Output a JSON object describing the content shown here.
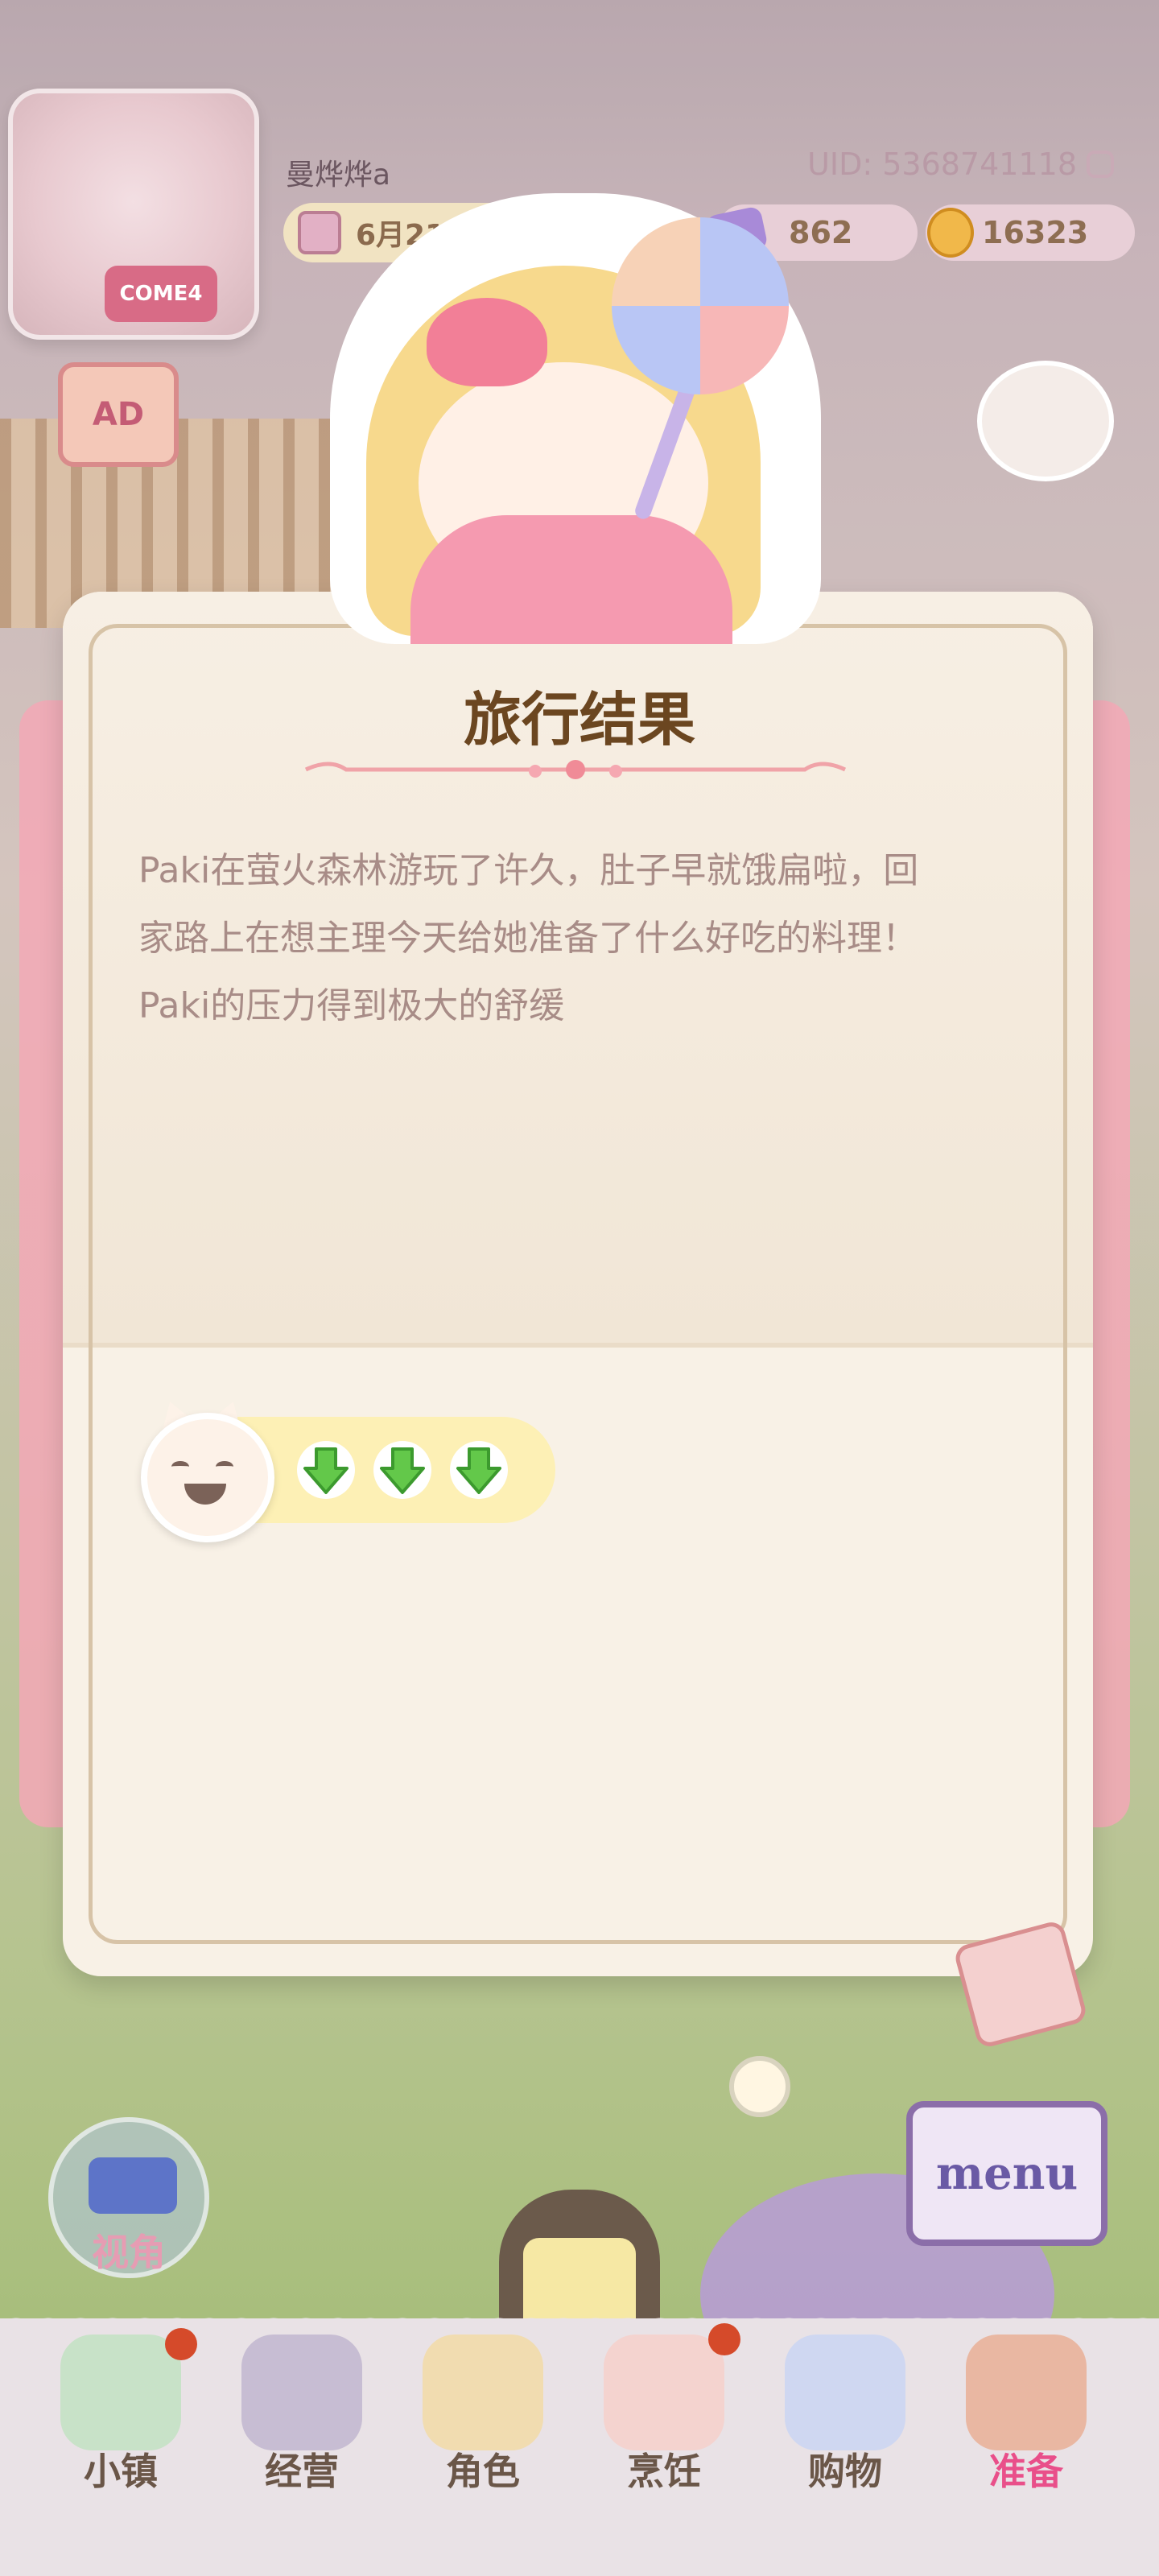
{
  "hud": {
    "username": "曼烨烨a",
    "uid": "UID: 5368741118",
    "date": "6月21日",
    "gems": "862",
    "coins": "16323",
    "ad_label": "AD",
    "badge_text": "COME4"
  },
  "dialog": {
    "title": "旅行结果",
    "description_lines": [
      "Paki在萤火森林游玩了许久，肚子早就饿扁啦，回",
      "家路上在想主理今天给她准备了什么好吃的料理！",
      "Paki的压力得到极大的舒缓"
    ],
    "stress_arrows": [
      "down-arrow",
      "down-arrow",
      "down-arrow"
    ],
    "arrow_color": "#63c84a"
  },
  "scene": {
    "camera_label": "视角",
    "menu_label": "menu"
  },
  "nav": {
    "items": [
      {
        "label": "小镇",
        "icon": "map-icon",
        "badge": true
      },
      {
        "label": "经营",
        "icon": "shop-bag-icon",
        "badge": false
      },
      {
        "label": "角色",
        "icon": "character-icon",
        "badge": false
      },
      {
        "label": "烹饪",
        "icon": "sandwich-icon",
        "badge": true
      },
      {
        "label": "购物",
        "icon": "shopping-bag-icon",
        "badge": false
      },
      {
        "label": "准备",
        "icon": "basket-icon",
        "badge": false,
        "active": true
      }
    ]
  },
  "colors": {
    "accent_pink": "#e94f8a",
    "title_brown": "#6b4620",
    "dialog_bg": "#f8f1e6"
  }
}
